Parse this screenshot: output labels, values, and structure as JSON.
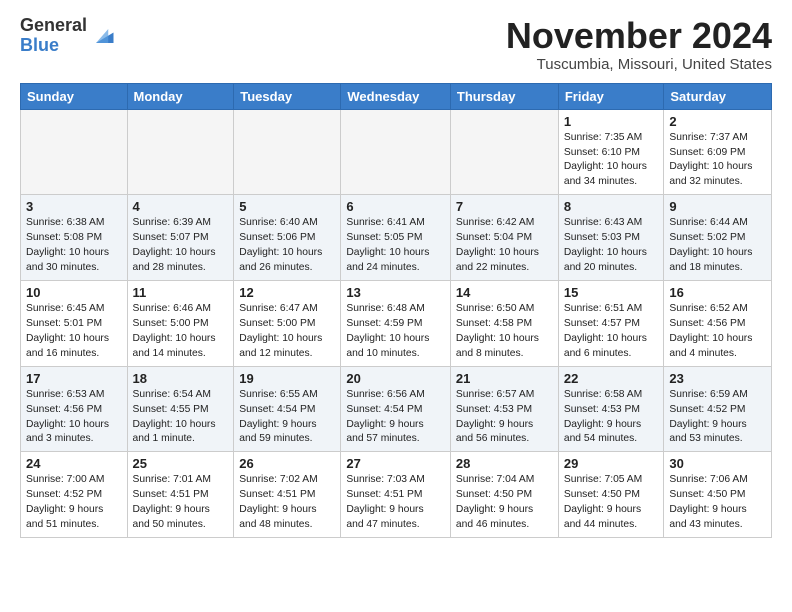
{
  "logo": {
    "general": "General",
    "blue": "Blue"
  },
  "title": "November 2024",
  "location": "Tuscumbia, Missouri, United States",
  "days_header": [
    "Sunday",
    "Monday",
    "Tuesday",
    "Wednesday",
    "Thursday",
    "Friday",
    "Saturday"
  ],
  "weeks": [
    {
      "shaded": false,
      "days": [
        {
          "num": "",
          "empty": true,
          "text": ""
        },
        {
          "num": "",
          "empty": true,
          "text": ""
        },
        {
          "num": "",
          "empty": true,
          "text": ""
        },
        {
          "num": "",
          "empty": true,
          "text": ""
        },
        {
          "num": "",
          "empty": true,
          "text": ""
        },
        {
          "num": "1",
          "empty": false,
          "text": "Sunrise: 7:35 AM\nSunset: 6:10 PM\nDaylight: 10 hours\nand 34 minutes."
        },
        {
          "num": "2",
          "empty": false,
          "text": "Sunrise: 7:37 AM\nSunset: 6:09 PM\nDaylight: 10 hours\nand 32 minutes."
        }
      ]
    },
    {
      "shaded": true,
      "days": [
        {
          "num": "3",
          "empty": false,
          "text": "Sunrise: 6:38 AM\nSunset: 5:08 PM\nDaylight: 10 hours\nand 30 minutes."
        },
        {
          "num": "4",
          "empty": false,
          "text": "Sunrise: 6:39 AM\nSunset: 5:07 PM\nDaylight: 10 hours\nand 28 minutes."
        },
        {
          "num": "5",
          "empty": false,
          "text": "Sunrise: 6:40 AM\nSunset: 5:06 PM\nDaylight: 10 hours\nand 26 minutes."
        },
        {
          "num": "6",
          "empty": false,
          "text": "Sunrise: 6:41 AM\nSunset: 5:05 PM\nDaylight: 10 hours\nand 24 minutes."
        },
        {
          "num": "7",
          "empty": false,
          "text": "Sunrise: 6:42 AM\nSunset: 5:04 PM\nDaylight: 10 hours\nand 22 minutes."
        },
        {
          "num": "8",
          "empty": false,
          "text": "Sunrise: 6:43 AM\nSunset: 5:03 PM\nDaylight: 10 hours\nand 20 minutes."
        },
        {
          "num": "9",
          "empty": false,
          "text": "Sunrise: 6:44 AM\nSunset: 5:02 PM\nDaylight: 10 hours\nand 18 minutes."
        }
      ]
    },
    {
      "shaded": false,
      "days": [
        {
          "num": "10",
          "empty": false,
          "text": "Sunrise: 6:45 AM\nSunset: 5:01 PM\nDaylight: 10 hours\nand 16 minutes."
        },
        {
          "num": "11",
          "empty": false,
          "text": "Sunrise: 6:46 AM\nSunset: 5:00 PM\nDaylight: 10 hours\nand 14 minutes."
        },
        {
          "num": "12",
          "empty": false,
          "text": "Sunrise: 6:47 AM\nSunset: 5:00 PM\nDaylight: 10 hours\nand 12 minutes."
        },
        {
          "num": "13",
          "empty": false,
          "text": "Sunrise: 6:48 AM\nSunset: 4:59 PM\nDaylight: 10 hours\nand 10 minutes."
        },
        {
          "num": "14",
          "empty": false,
          "text": "Sunrise: 6:50 AM\nSunset: 4:58 PM\nDaylight: 10 hours\nand 8 minutes."
        },
        {
          "num": "15",
          "empty": false,
          "text": "Sunrise: 6:51 AM\nSunset: 4:57 PM\nDaylight: 10 hours\nand 6 minutes."
        },
        {
          "num": "16",
          "empty": false,
          "text": "Sunrise: 6:52 AM\nSunset: 4:56 PM\nDaylight: 10 hours\nand 4 minutes."
        }
      ]
    },
    {
      "shaded": true,
      "days": [
        {
          "num": "17",
          "empty": false,
          "text": "Sunrise: 6:53 AM\nSunset: 4:56 PM\nDaylight: 10 hours\nand 3 minutes."
        },
        {
          "num": "18",
          "empty": false,
          "text": "Sunrise: 6:54 AM\nSunset: 4:55 PM\nDaylight: 10 hours\nand 1 minute."
        },
        {
          "num": "19",
          "empty": false,
          "text": "Sunrise: 6:55 AM\nSunset: 4:54 PM\nDaylight: 9 hours\nand 59 minutes."
        },
        {
          "num": "20",
          "empty": false,
          "text": "Sunrise: 6:56 AM\nSunset: 4:54 PM\nDaylight: 9 hours\nand 57 minutes."
        },
        {
          "num": "21",
          "empty": false,
          "text": "Sunrise: 6:57 AM\nSunset: 4:53 PM\nDaylight: 9 hours\nand 56 minutes."
        },
        {
          "num": "22",
          "empty": false,
          "text": "Sunrise: 6:58 AM\nSunset: 4:53 PM\nDaylight: 9 hours\nand 54 minutes."
        },
        {
          "num": "23",
          "empty": false,
          "text": "Sunrise: 6:59 AM\nSunset: 4:52 PM\nDaylight: 9 hours\nand 53 minutes."
        }
      ]
    },
    {
      "shaded": false,
      "days": [
        {
          "num": "24",
          "empty": false,
          "text": "Sunrise: 7:00 AM\nSunset: 4:52 PM\nDaylight: 9 hours\nand 51 minutes."
        },
        {
          "num": "25",
          "empty": false,
          "text": "Sunrise: 7:01 AM\nSunset: 4:51 PM\nDaylight: 9 hours\nand 50 minutes."
        },
        {
          "num": "26",
          "empty": false,
          "text": "Sunrise: 7:02 AM\nSunset: 4:51 PM\nDaylight: 9 hours\nand 48 minutes."
        },
        {
          "num": "27",
          "empty": false,
          "text": "Sunrise: 7:03 AM\nSunset: 4:51 PM\nDaylight: 9 hours\nand 47 minutes."
        },
        {
          "num": "28",
          "empty": false,
          "text": "Sunrise: 7:04 AM\nSunset: 4:50 PM\nDaylight: 9 hours\nand 46 minutes."
        },
        {
          "num": "29",
          "empty": false,
          "text": "Sunrise: 7:05 AM\nSunset: 4:50 PM\nDaylight: 9 hours\nand 44 minutes."
        },
        {
          "num": "30",
          "empty": false,
          "text": "Sunrise: 7:06 AM\nSunset: 4:50 PM\nDaylight: 9 hours\nand 43 minutes."
        }
      ]
    }
  ]
}
